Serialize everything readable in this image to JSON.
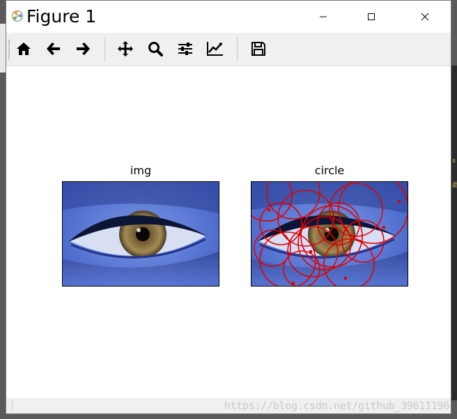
{
  "window": {
    "title": "Figure 1",
    "minimize_glyph": "minimize-icon",
    "maximize_glyph": "maximize-icon",
    "close_glyph": "close-icon"
  },
  "toolbar": {
    "items": [
      {
        "name": "home-icon",
        "tooltip": ""
      },
      {
        "name": "back-arrow-icon",
        "tooltip": ""
      },
      {
        "name": "forward-arrow-icon",
        "tooltip": ""
      },
      {
        "name": "pan-move-icon",
        "tooltip": ""
      },
      {
        "name": "zoom-magnifier-icon",
        "tooltip": ""
      },
      {
        "name": "configure-subplots-icon",
        "tooltip": ""
      },
      {
        "name": "edit-axis-curve-icon",
        "tooltip": ""
      },
      {
        "name": "save-floppy-icon",
        "tooltip": ""
      }
    ]
  },
  "figure": {
    "axes_left": {
      "title": "img",
      "content": "photo of a blue-tinted eye"
    },
    "axes_right": {
      "title": "circle",
      "content": "same eye photo with detected circles drawn in red"
    },
    "circle_color": "#e00000"
  },
  "status": {
    "watermark": "https://blog.csdn.net/github_39611196"
  },
  "background": {
    "right_glyphs": [
      "s",
      "此"
    ]
  }
}
